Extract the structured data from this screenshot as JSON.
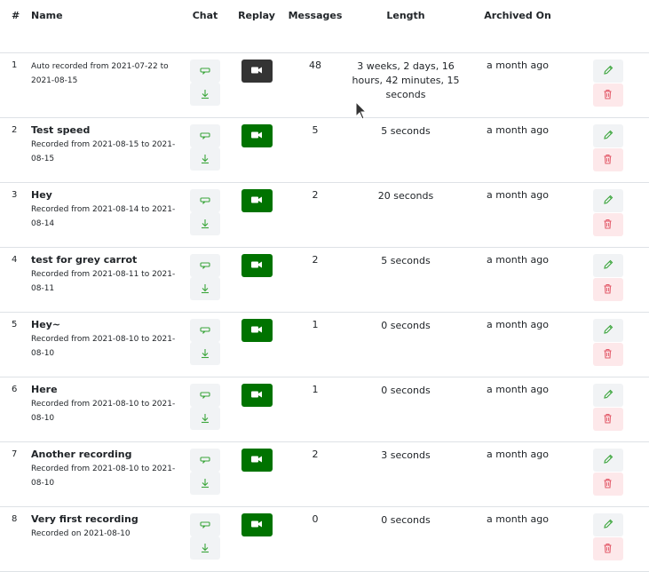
{
  "headers": {
    "num": "#",
    "name": "Name",
    "chat": "Chat",
    "replay": "Replay",
    "messages": "Messages",
    "length": "Length",
    "archived": "Archived On"
  },
  "colors": {
    "replay_green": "#007300",
    "replay_dark": "#343434",
    "icon_green": "#3aa53a",
    "icon_red": "#e35b6a"
  },
  "rows": [
    {
      "num": "1",
      "title": "Auto recorded from 2021-07-22 to 2021-08-15",
      "desc": "",
      "messages": "48",
      "length": "3 weeks, 2 days, 16 hours, 42 minutes, 15 seconds",
      "archived": "a month ago"
    },
    {
      "num": "2",
      "title": "Test speed",
      "desc": "Recorded from 2021-08-15 to 2021-08-15",
      "messages": "5",
      "length": "5 seconds",
      "archived": "a month ago"
    },
    {
      "num": "3",
      "title": "Hey",
      "desc": "Recorded from 2021-08-14 to 2021-08-14",
      "messages": "2",
      "length": "20 seconds",
      "archived": "a month ago"
    },
    {
      "num": "4",
      "title": "test for grey carrot",
      "desc": "Recorded from 2021-08-11 to 2021-08-11",
      "messages": "2",
      "length": "5 seconds",
      "archived": "a month ago"
    },
    {
      "num": "5",
      "title": "Hey~",
      "desc": "Recorded from 2021-08-10 to 2021-08-10",
      "messages": "1",
      "length": "0 seconds",
      "archived": "a month ago"
    },
    {
      "num": "6",
      "title": "Here",
      "desc": "Recorded from 2021-08-10 to 2021-08-10",
      "messages": "1",
      "length": "0 seconds",
      "archived": "a month ago"
    },
    {
      "num": "7",
      "title": "Another recording",
      "desc": "Recorded from 2021-08-10 to 2021-08-10",
      "messages": "2",
      "length": "3 seconds",
      "archived": "a month ago"
    },
    {
      "num": "8",
      "title": "Very first recording",
      "desc": "Recorded on 2021-08-10",
      "messages": "0",
      "length": "0 seconds",
      "archived": "a month ago"
    }
  ]
}
